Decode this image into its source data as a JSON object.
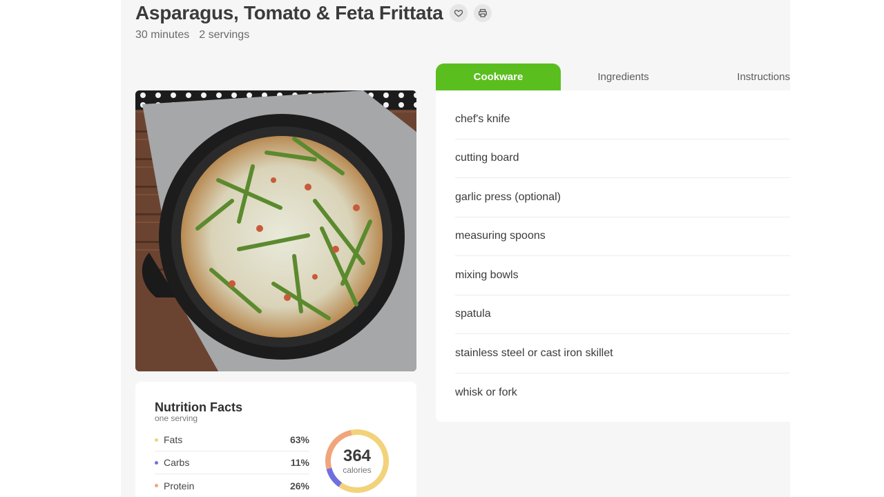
{
  "recipe": {
    "title": "Asparagus, Tomato & Feta Frittata",
    "time": "30 minutes",
    "servings": "2 servings",
    "favorite_icon": "heart-icon",
    "print_icon": "printer-icon"
  },
  "tabs": [
    {
      "label": "Cookware",
      "active": true
    },
    {
      "label": "Ingredients",
      "active": false
    },
    {
      "label": "Instructions",
      "active": false
    }
  ],
  "cookware": [
    "chef's knife",
    "cutting board",
    "garlic press (optional)",
    "measuring spoons",
    "mixing bowls",
    "spatula",
    "stainless steel or cast iron skillet",
    "whisk or fork"
  ],
  "nutrition": {
    "title": "Nutrition Facts",
    "subtitle": "one serving",
    "calories": "364",
    "calories_label": "calories",
    "rows": [
      {
        "label": "Fats",
        "value": "63%",
        "color": "#f2d27a"
      },
      {
        "label": "Carbs",
        "value": "11%",
        "color": "#6f6fe0"
      },
      {
        "label": "Protein",
        "value": "26%",
        "color": "#f0a57a"
      }
    ]
  },
  "colors": {
    "accent": "#5bbe1f"
  }
}
